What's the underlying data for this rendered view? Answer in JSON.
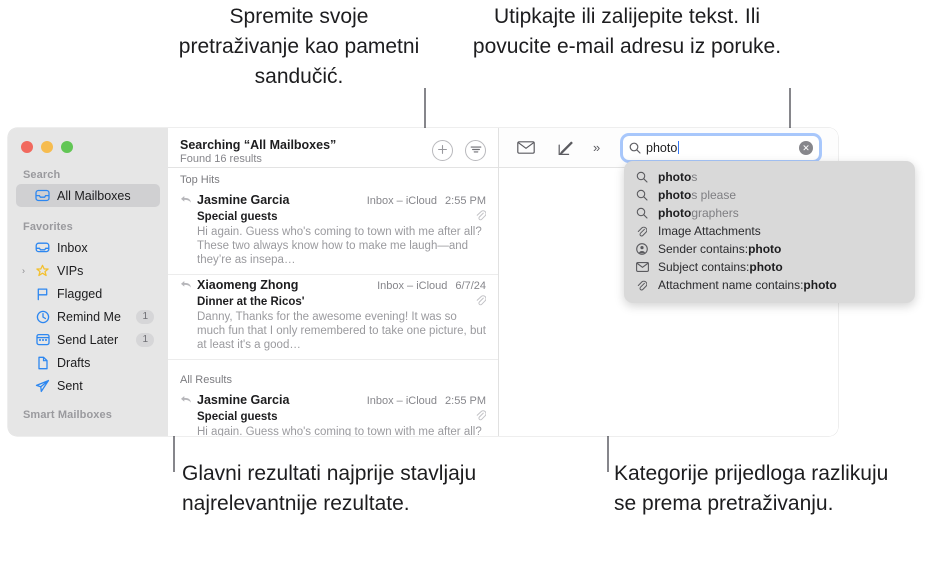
{
  "callouts": {
    "top_left": "Spremite svoje pretraživanje kao pametni sandučić.",
    "top_right": "Utipkajte ili zalijepite tekst. Ili povucite e-mail adresu iz poruke.",
    "bottom_left": "Glavni rezultati najprije stavljaju najrelevantnije rezultate.",
    "bottom_right": "Kategorije prijedloga razlikuju se prema pretraživanju."
  },
  "sidebar": {
    "sections": [
      {
        "label": "Search"
      },
      {
        "label": "Favorites"
      },
      {
        "label": "Smart Mailboxes"
      }
    ],
    "search_items": [
      {
        "label": "All Mailboxes",
        "icon": "all-mailboxes-icon",
        "selected": true
      }
    ],
    "favorites_items": [
      {
        "label": "Inbox",
        "icon": "inbox-icon",
        "badge": "",
        "disclosure": ""
      },
      {
        "label": "VIPs",
        "icon": "star-icon",
        "badge": "",
        "disclosure": "›"
      },
      {
        "label": "Flagged",
        "icon": "flag-icon",
        "badge": "",
        "disclosure": ""
      },
      {
        "label": "Remind Me",
        "icon": "clock-icon",
        "badge": "1",
        "disclosure": ""
      },
      {
        "label": "Send Later",
        "icon": "calendar-icon",
        "badge": "1",
        "disclosure": ""
      },
      {
        "label": "Drafts",
        "icon": "document-icon",
        "badge": "",
        "disclosure": ""
      },
      {
        "label": "Sent",
        "icon": "paper-plane-icon",
        "badge": "",
        "disclosure": ""
      }
    ]
  },
  "message_list": {
    "title": "Searching “All Mailboxes”",
    "subtitle": "Found 16 results",
    "save_search_icon": "plus-circle-icon",
    "filter_icon": "filter-circle-icon",
    "groups": [
      {
        "label": "Top Hits",
        "messages": [
          {
            "from": "Jasmine Garcia",
            "mailbox": "Inbox – iCloud",
            "date": "2:55 PM",
            "subject": "Special guests",
            "snippet": "Hi again. Guess who's coming to town with me after all? These two always know how to make me laugh—and they’re as insepa…",
            "has_attachment": true
          },
          {
            "from": "Xiaomeng Zhong",
            "mailbox": "Inbox – iCloud",
            "date": "6/7/24",
            "subject": "Dinner at the Ricos'",
            "snippet": "Danny, Thanks for the awesome evening! It was so much fun that I only remembered to take one picture, but at least it's a good…",
            "has_attachment": true
          }
        ]
      },
      {
        "label": "All Results",
        "messages": [
          {
            "from": "Jasmine Garcia",
            "mailbox": "Inbox – iCloud",
            "date": "2:55 PM",
            "subject": "Special guests",
            "snippet": "Hi again. Guess who's coming to town with me after all? These two always know how to make me laugh—and they’re as insepa…",
            "has_attachment": true
          }
        ]
      }
    ]
  },
  "toolbar": {
    "mail_icon": "envelope-icon",
    "compose_icon": "compose-icon",
    "overflow_label": "»"
  },
  "search": {
    "value": "photo",
    "magnifier_icon": "search-icon",
    "clear_icon": "clear-circle-icon",
    "clear_glyph": "✕"
  },
  "suggestions": [
    {
      "icon": "search-icon",
      "match": "photo",
      "rest": "s",
      "prefix": ""
    },
    {
      "icon": "search-icon",
      "match": "photo",
      "rest": "s please",
      "prefix": ""
    },
    {
      "icon": "search-icon",
      "match": "photo",
      "rest": "graphers",
      "prefix": ""
    },
    {
      "icon": "paperclip-icon",
      "match": "",
      "rest": "",
      "prefix": "Image Attachments"
    },
    {
      "icon": "person-circle-icon",
      "match": "photo",
      "rest": "",
      "prefix": "Sender contains: "
    },
    {
      "icon": "envelope-icon",
      "match": "photo",
      "rest": "",
      "prefix": "Subject contains: "
    },
    {
      "icon": "paperclip-icon",
      "match": "photo",
      "rest": "",
      "prefix": "Attachment name contains: "
    }
  ],
  "colors": {
    "accent_blue": "#0a64ff",
    "icon_blue": "#2d87f0",
    "star_gold": "#f3c02e",
    "traffic_red": "#f1695e",
    "traffic_yellow": "#f6bc4f",
    "traffic_green": "#62c655"
  }
}
